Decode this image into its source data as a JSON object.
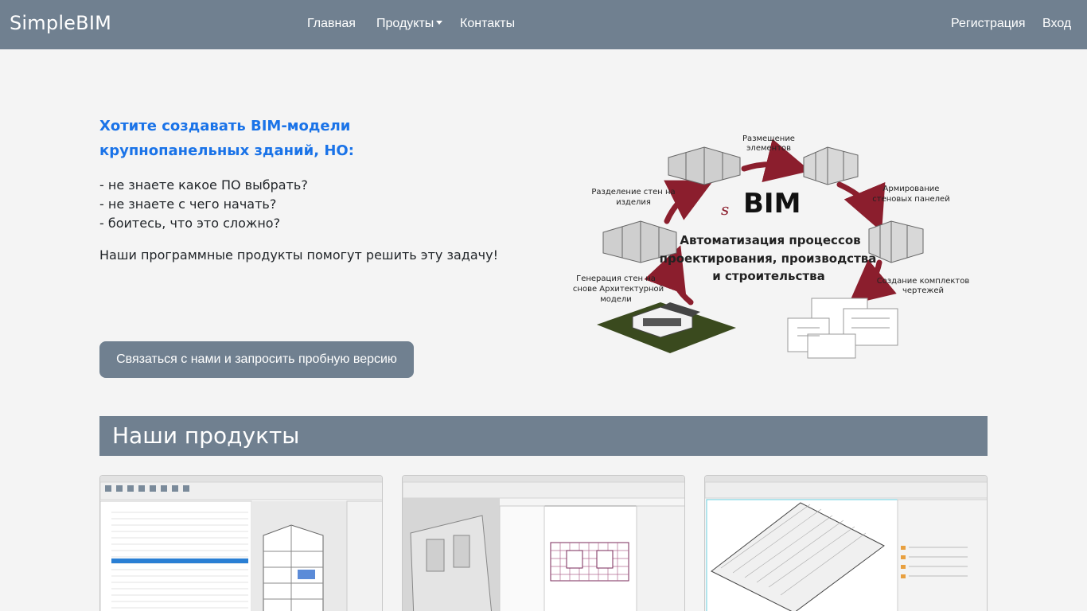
{
  "navbar": {
    "brand": "SimpleBIM",
    "links": {
      "home": "Главная",
      "products": "Продукты",
      "contacts": "Контакты",
      "register": "Регистрация",
      "login": "Вход"
    }
  },
  "hero": {
    "title": "Хотите создавать BIM-модели крупнопанельных зданий, НО:",
    "lines": [
      "- не знаете какое ПО выбрать?",
      "- не знаете с чего начать?",
      "- боитесь, что это сложно?"
    ],
    "tagline": "Наши программные продукты помогут решить эту задачу!",
    "cta_label": "Связаться с нами и запросить пробную версию"
  },
  "diagram": {
    "logo": "BIM",
    "logo_prefix": "s",
    "center_lines": [
      "Автоматизация процессов",
      "проектирования, производства",
      "и строительства"
    ],
    "labels": {
      "placement": [
        "Размещение",
        "элементов"
      ],
      "reinforcement": [
        "Армирование",
        "стеновых панелей"
      ],
      "drawings": [
        "Создание комплектов",
        "чертежей"
      ],
      "generation": [
        "Генерация стен на",
        "основе Архитектурной",
        "модели"
      ],
      "division": [
        "Разделение стен на",
        "изделия"
      ]
    },
    "arrow_color": "#8b1e2d"
  },
  "products": {
    "heading": "Наши продукты"
  },
  "colors": {
    "navbar": "#708090",
    "accent_blue": "#1a73e8",
    "background": "#f4f4f4"
  }
}
